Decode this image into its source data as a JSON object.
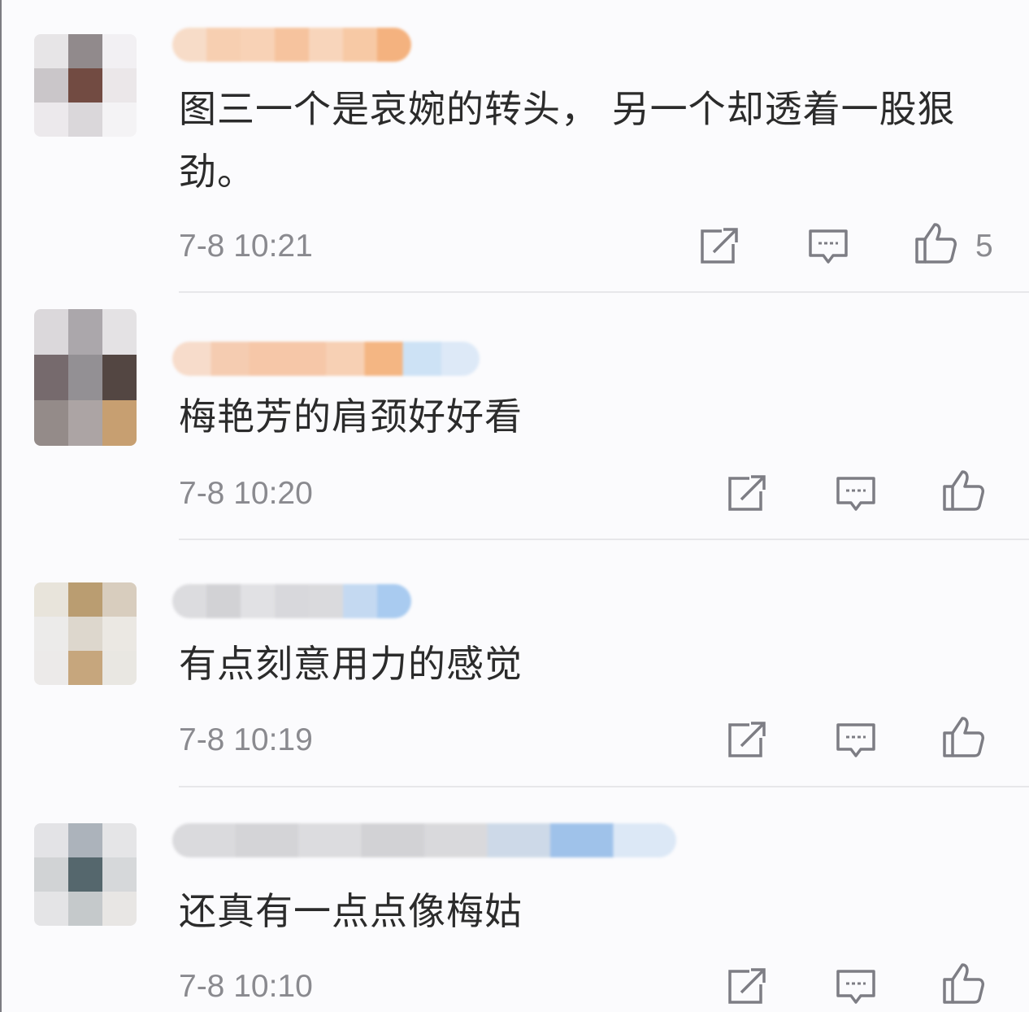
{
  "comments": [
    {
      "text": "图三一个是哀婉的转头， 另一个却透着一股狠劲。",
      "time": "7-8 10:21",
      "likes": "5",
      "avatar_colors": [
        "#e6e4e6",
        "#8c8586",
        "#f2f0f3",
        "#c8c4c7",
        "#6b4239",
        "#ebe6e8",
        "#ece9ec",
        "#d9d6d9",
        "#f4f3f5"
      ],
      "name_colors": [
        "#f7dcc8",
        "#f7cfb1",
        "#f8d2b6",
        "#f6c39e",
        "#f8d5bb",
        "#f7c9a5",
        "#f4b27f"
      ]
    },
    {
      "text": "梅艳芳的肩颈好好看",
      "time": "7-8 10:20",
      "likes": "",
      "avatar_colors": [
        "#dad7da",
        "#a7a3a7",
        "#e3e1e3",
        "#6f6366",
        "#8e8b8f",
        "#4b3d38",
        "#8f8683",
        "#a8a0a0",
        "#c59b6a"
      ],
      "name_colors": [
        "#f7dccb",
        "#f5ccb1",
        "#f6c7a8",
        "#f6c7a8",
        "#f7d0b4",
        "#f4b683",
        "#cde2f5",
        "#dde9f7"
      ]
    },
    {
      "text": "有点刻意用力的感觉",
      "time": "7-8 10:19",
      "likes": "",
      "avatar_colors": [
        "#e7e3da",
        "#b7986a",
        "#d7cbbb",
        "#ecebea",
        "#dcd6cb",
        "#ebe8e2",
        "#eceae8",
        "#c4a277",
        "#e9e6e1"
      ],
      "name_colors": [
        "#dcdcdf",
        "#d2d2d5",
        "#e1e1e4",
        "#d8d8dc",
        "#dadadd",
        "#c4d9f1",
        "#a9cbf0"
      ]
    },
    {
      "text": "还真有一点点像梅姑",
      "time": "7-8 10:10",
      "likes": "",
      "avatar_colors": [
        "#e2e2e5",
        "#a8b0b8",
        "#e4e4e6",
        "#cfd1d3",
        "#4d6066",
        "#d5d7d9",
        "#e3e3e5",
        "#c3c7c9",
        "#e7e5e3"
      ],
      "name_colors": [
        "#dadadd",
        "#d4d4d7",
        "#dcdcdf",
        "#d2d2d5",
        "#d9d9dc",
        "#cdd9e8",
        "#9fc2ea",
        "#dce8f6"
      ]
    }
  ]
}
